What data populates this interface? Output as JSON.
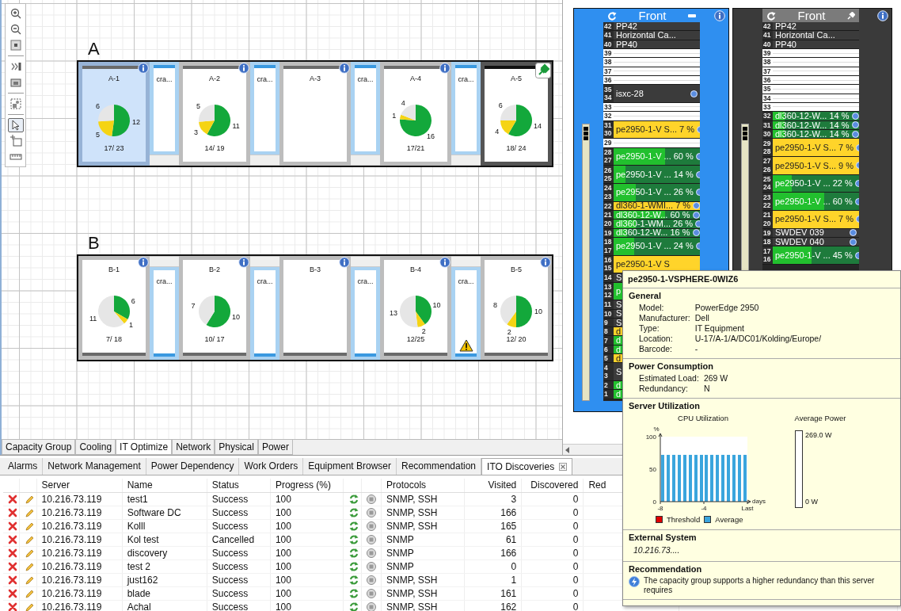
{
  "canvas": {
    "toolbar": [
      {
        "kind": "zoom-in",
        "selected": false
      },
      {
        "kind": "zoom-out",
        "selected": false
      },
      {
        "kind": "fit",
        "selected": false
      },
      {
        "kind": "separator"
      },
      {
        "kind": "chevrons",
        "selected": false
      },
      {
        "kind": "image",
        "selected": false
      },
      {
        "kind": "separator"
      },
      {
        "kind": "group",
        "selected": false
      },
      {
        "kind": "separator"
      },
      {
        "kind": "pointer",
        "selected": true
      },
      {
        "kind": "rectangle",
        "selected": false
      },
      {
        "kind": "ruler",
        "selected": false
      }
    ],
    "rows": [
      {
        "label": "A",
        "flipped": false,
        "items": [
          {
            "kind": "rack",
            "label": "A-1",
            "selected": true,
            "pinned": false,
            "count": "17/ 23",
            "chart_data": {
              "type": "pie",
              "data_labels": true,
              "values": [
                12,
                5,
                6
              ]
            }
          },
          {
            "kind": "crac",
            "label": "cra...",
            "warning": false
          },
          {
            "kind": "rack",
            "label": "A-2",
            "selected": false,
            "pinned": false,
            "count": "14/ 19",
            "chart_data": {
              "type": "pie",
              "data_labels": true,
              "values": [
                11,
                3,
                5
              ]
            }
          },
          {
            "kind": "crac",
            "label": "cra...",
            "warning": false
          },
          {
            "kind": "rack",
            "label": "A-3",
            "selected": false,
            "pinned": false
          },
          {
            "kind": "crac",
            "label": "cra...",
            "warning": false
          },
          {
            "kind": "rack",
            "label": "A-4",
            "selected": false,
            "pinned": false,
            "count": "17/21",
            "chart_data": {
              "type": "pie",
              "data_labels": true,
              "values": [
                16,
                1,
                4
              ]
            }
          },
          {
            "kind": "crac",
            "label": "cra...",
            "warning": false
          },
          {
            "kind": "rack",
            "label": "A-5",
            "selected": false,
            "pinned": true,
            "count": "18/ 24",
            "chart_data": {
              "type": "pie",
              "data_labels": true,
              "values": [
                14,
                4,
                6
              ]
            }
          }
        ]
      },
      {
        "label": "B",
        "flipped": true,
        "items": [
          {
            "kind": "rack",
            "label": "B-1",
            "selected": false,
            "pinned": false,
            "count": "7/ 18",
            "chart_data": {
              "type": "pie",
              "data_labels": true,
              "values": [
                6,
                1,
                11
              ]
            }
          },
          {
            "kind": "crac",
            "label": "cra...",
            "warning": false
          },
          {
            "kind": "rack",
            "label": "B-2",
            "selected": false,
            "pinned": false,
            "count": "10/ 17",
            "chart_data": {
              "type": "pie",
              "data_labels": true,
              "values": [
                10,
                0,
                7
              ]
            }
          },
          {
            "kind": "crac",
            "label": "cra...",
            "warning": false
          },
          {
            "kind": "rack",
            "label": "B-3",
            "selected": false,
            "pinned": false
          },
          {
            "kind": "crac",
            "label": "cra...",
            "warning": false
          },
          {
            "kind": "rack",
            "label": "B-4",
            "selected": false,
            "pinned": false,
            "count": "12/25",
            "chart_data": {
              "type": "pie",
              "data_labels": true,
              "values": [
                10,
                2,
                13
              ]
            }
          },
          {
            "kind": "crac",
            "label": "cra...",
            "warning": true
          },
          {
            "kind": "rack",
            "label": "B-5",
            "selected": false,
            "pinned": false,
            "count": "12/ 20",
            "chart_data": {
              "type": "pie",
              "data_labels": true,
              "values": [
                10,
                2,
                8
              ]
            }
          }
        ]
      }
    ]
  },
  "view_tabs": [
    {
      "label": "Capacity Group",
      "selected": false
    },
    {
      "label": "Cooling",
      "selected": false
    },
    {
      "label": "IT Optimize",
      "selected": true
    },
    {
      "label": "Network",
      "selected": false
    },
    {
      "label": "Physical",
      "selected": false
    },
    {
      "label": "Power",
      "selected": false
    }
  ],
  "rack_views": [
    {
      "title": "Front",
      "selected": true,
      "pinned": false,
      "units": [
        {
          "u": [
            "42"
          ],
          "kind": "device",
          "label": "PP42"
        },
        {
          "u": [
            "41"
          ],
          "kind": "device",
          "label": "Horizontal Ca..."
        },
        {
          "u": [
            "40"
          ],
          "kind": "device",
          "label": "PP40"
        },
        {
          "u": [
            "39"
          ],
          "kind": "empty"
        },
        {
          "u": [
            "38"
          ],
          "kind": "empty"
        },
        {
          "u": [
            "37"
          ],
          "kind": "empty"
        },
        {
          "u": [
            "36"
          ],
          "kind": "empty"
        },
        {
          "u": [
            "35",
            "34"
          ],
          "kind": "device",
          "label": "isxc-28",
          "info": true
        },
        {
          "u": [
            "33"
          ],
          "kind": "empty"
        },
        {
          "u": [
            "32"
          ],
          "kind": "empty"
        },
        {
          "u": [
            "31",
            "30"
          ],
          "kind": "low",
          "label": "pe2950-1-V S...",
          "reading": "7 %",
          "info": true
        },
        {
          "u": [
            "29"
          ],
          "kind": "empty"
        },
        {
          "u": [
            "28",
            "27"
          ],
          "kind": "server",
          "label": "pe2950-1-V ...",
          "reading": "60 %",
          "level": 0.6,
          "info": true
        },
        {
          "u": [
            "26",
            "25"
          ],
          "kind": "server",
          "label": "pe2950-1-V ...",
          "reading": "14 %",
          "level": 0.14,
          "info": true
        },
        {
          "u": [
            "24",
            "23"
          ],
          "kind": "server",
          "label": "pe2950-1-V ...",
          "reading": "26 %",
          "level": 0.26,
          "info": true
        },
        {
          "u": [
            "22"
          ],
          "kind": "low",
          "label": "dl360-1-WMI...",
          "reading": "7 %",
          "info": true
        },
        {
          "u": [
            "21"
          ],
          "kind": "server",
          "label": "dl360-12-W...",
          "reading": "60 %",
          "level": 0.6,
          "info": true
        },
        {
          "u": [
            "20"
          ],
          "kind": "server",
          "label": "dl360-1-WM...",
          "reading": "26 %",
          "level": 0.26,
          "info": true
        },
        {
          "u": [
            "19"
          ],
          "kind": "server",
          "label": "dl360-12-W...",
          "reading": "16 %",
          "level": 0.16,
          "info": true
        },
        {
          "u": [
            "18",
            "17"
          ],
          "kind": "server",
          "label": "pe2950-1-V ...",
          "reading": "24 %",
          "level": 0.24,
          "info": true
        },
        {
          "u": [
            "16",
            "15"
          ],
          "kind": "low",
          "label": "pe2950-1-V S"
        },
        {
          "u": [
            "14"
          ],
          "kind": "device",
          "label": "S"
        },
        {
          "u": [
            "13",
            "12"
          ],
          "kind": "server",
          "label": "p"
        },
        {
          "u": [
            "11"
          ],
          "kind": "device",
          "label": "S"
        },
        {
          "u": [
            "10"
          ],
          "kind": "device",
          "label": "S"
        },
        {
          "u": [
            "9"
          ],
          "kind": "device",
          "label": "S"
        },
        {
          "u": [
            "8"
          ],
          "kind": "low",
          "label": "d"
        },
        {
          "u": [
            "7"
          ],
          "kind": "server",
          "label": "d"
        },
        {
          "u": [
            "6"
          ],
          "kind": "server",
          "label": "d"
        },
        {
          "u": [
            "5"
          ],
          "kind": "low",
          "label": "d"
        },
        {
          "u": [
            "4",
            "3"
          ],
          "kind": "device",
          "label": "S"
        },
        {
          "u": [
            "2"
          ],
          "kind": "server",
          "label": "d"
        },
        {
          "u": [
            "1"
          ],
          "kind": "server",
          "label": "d"
        }
      ]
    },
    {
      "title": "Front",
      "selected": false,
      "pinned": true,
      "units": [
        {
          "u": [
            "42"
          ],
          "kind": "device",
          "label": "PP42"
        },
        {
          "u": [
            "41"
          ],
          "kind": "device",
          "label": "Horizontal Ca..."
        },
        {
          "u": [
            "40"
          ],
          "kind": "device",
          "label": "PP40"
        },
        {
          "u": [
            "39"
          ],
          "kind": "empty"
        },
        {
          "u": [
            "38"
          ],
          "kind": "empty"
        },
        {
          "u": [
            "37"
          ],
          "kind": "empty"
        },
        {
          "u": [
            "36"
          ],
          "kind": "empty"
        },
        {
          "u": [
            "35"
          ],
          "kind": "empty"
        },
        {
          "u": [
            "34"
          ],
          "kind": "empty"
        },
        {
          "u": [
            "33"
          ],
          "kind": "empty"
        },
        {
          "u": [
            "32"
          ],
          "kind": "server",
          "label": "dl360-12-W...",
          "reading": "14 %",
          "level": 0.14,
          "info": true
        },
        {
          "u": [
            "31"
          ],
          "kind": "server",
          "label": "dl360-12-W...",
          "reading": "14 %",
          "level": 0.14,
          "info": true
        },
        {
          "u": [
            "30"
          ],
          "kind": "server",
          "label": "dl360-12-W...",
          "reading": "14 %",
          "level": 0.14,
          "info": true
        },
        {
          "u": [
            "29",
            "28"
          ],
          "kind": "low",
          "label": "pe2950-1-V S...",
          "reading": "7 %",
          "info": true
        },
        {
          "u": [
            "27",
            "26"
          ],
          "kind": "low",
          "label": "pe2950-1-V S...",
          "reading": "9 %",
          "info": true
        },
        {
          "u": [
            "25",
            "24"
          ],
          "kind": "server",
          "label": "pe2950-1-V ...",
          "reading": "22 %",
          "level": 0.22,
          "info": true
        },
        {
          "u": [
            "23",
            "22"
          ],
          "kind": "server",
          "label": "pe2950-1-V ...",
          "reading": "60 %",
          "level": 0.6,
          "info": true
        },
        {
          "u": [
            "21",
            "20"
          ],
          "kind": "low",
          "label": "pe2950-1-V S...",
          "reading": "7 %",
          "info": true
        },
        {
          "u": [
            "19"
          ],
          "kind": "device",
          "label": "SWDEV 039",
          "info": true
        },
        {
          "u": [
            "18"
          ],
          "kind": "device",
          "label": "SWDEV 040",
          "info": true
        },
        {
          "u": [
            "17",
            "16"
          ],
          "kind": "server",
          "label": "pe2950-1-V ...",
          "reading": "45 %",
          "level": 0.45,
          "info": true
        }
      ]
    }
  ],
  "tooltip": {
    "title": "pe2950-1-VSPHERE-0WIZ6",
    "sections": [
      {
        "kind": "fields",
        "heading": "General",
        "fields": [
          {
            "label": "Model:",
            "value": "PowerEdge 2950"
          },
          {
            "label": "Manufacturer:",
            "value": "Dell"
          },
          {
            "label": "Type:",
            "value": "IT Equipment"
          },
          {
            "label": "Location:",
            "value": "U-17/A-1/A/DC01/Kolding/Europe/"
          },
          {
            "label": "Barcode:",
            "value": "-"
          }
        ]
      },
      {
        "kind": "fields",
        "heading": "Power Consumption",
        "fields": [
          {
            "label": "Estimated Load:",
            "value": "269 W"
          },
          {
            "label": "Redundancy:",
            "value": "N"
          }
        ]
      },
      {
        "kind": "charts",
        "heading": "Server Utilization",
        "cpu": {
          "title": "CPU Utilization",
          "threshold": {
            "name": "Threshold",
            "color": "#e00000"
          },
          "chart_data": {
            "type": "bar",
            "xlabel": "days",
            "ylabel": "%",
            "x": [
              -7.75,
              -7.25,
              -6.75,
              -6.25,
              -5.75,
              -5.25,
              -4.75,
              -4.25,
              -3.75,
              -3.25,
              -2.75,
              -2.25,
              -1.75,
              -1.25,
              -0.75,
              -0.25
            ],
            "series": [
              {
                "name": "Average",
                "color": "#3aa5dd",
                "values": [
                  72,
                  72,
                  72,
                  72,
                  72,
                  72,
                  72,
                  72,
                  72,
                  72,
                  72,
                  72,
                  72,
                  72,
                  72,
                  72
                ]
              }
            ],
            "xlim": [
              -8,
              0
            ],
            "ylim": [
              0,
              100
            ],
            "xticks": [
              {
                "value": -8,
                "label": "-8"
              },
              {
                "value": -4,
                "label": "-4"
              },
              {
                "value": 0,
                "label": "Last"
              }
            ],
            "yticks": [
              0,
              50,
              100
            ]
          }
        },
        "power": {
          "title": "Average Power",
          "level": 0,
          "max": "269.0 W",
          "min": "0 W"
        }
      },
      {
        "kind": "note",
        "heading": "External System",
        "text": "10.216.73...."
      },
      {
        "kind": "recommendation",
        "heading": "Recommendation",
        "text": "The capacity group supports a higher redundancy than this server requires"
      }
    ]
  },
  "panel_tabs": [
    {
      "label": "Alarms",
      "selected": false,
      "closable": false
    },
    {
      "label": "Network Management",
      "selected": false,
      "closable": false
    },
    {
      "label": "Power Dependency",
      "selected": false,
      "closable": false
    },
    {
      "label": "Work Orders",
      "selected": false,
      "closable": false
    },
    {
      "label": "Equipment Browser",
      "selected": false,
      "closable": false
    },
    {
      "label": "Recommendation",
      "selected": false,
      "closable": false
    },
    {
      "label": "ITO Discoveries",
      "selected": true,
      "closable": true
    }
  ],
  "table": {
    "columns": [
      "Server",
      "Name",
      "Status",
      "Progress (%)",
      "Protocols",
      "Visited",
      "Discovered",
      "Red"
    ],
    "rows": [
      [
        "10.216.73.119",
        "test1",
        "Success",
        "100",
        "SNMP, SSH",
        "3",
        "0"
      ],
      [
        "10.216.73.119",
        "Software DC",
        "Success",
        "100",
        "SNMP, SSH",
        "166",
        "0"
      ],
      [
        "10.216.73.119",
        "Kolll",
        "Success",
        "100",
        "SNMP, SSH",
        "165",
        "0"
      ],
      [
        "10.216.73.119",
        "Kol test",
        "Cancelled",
        "100",
        "SNMP",
        "61",
        "0"
      ],
      [
        "10.216.73.119",
        "discovery",
        "Success",
        "100",
        "SNMP",
        "166",
        "0"
      ],
      [
        "10.216.73.119",
        "test 2",
        "Success",
        "100",
        "SNMP",
        "0",
        "0"
      ],
      [
        "10.216.73.119",
        "just162",
        "Success",
        "100",
        "SNMP, SSH",
        "1",
        "0"
      ],
      [
        "10.216.73.119",
        "blade",
        "Success",
        "100",
        "SNMP, SSH",
        "161",
        "0"
      ],
      [
        "10.216.73.119",
        "Achal",
        "Success",
        "100",
        "SNMP, SSH",
        "162",
        "0"
      ]
    ]
  }
}
